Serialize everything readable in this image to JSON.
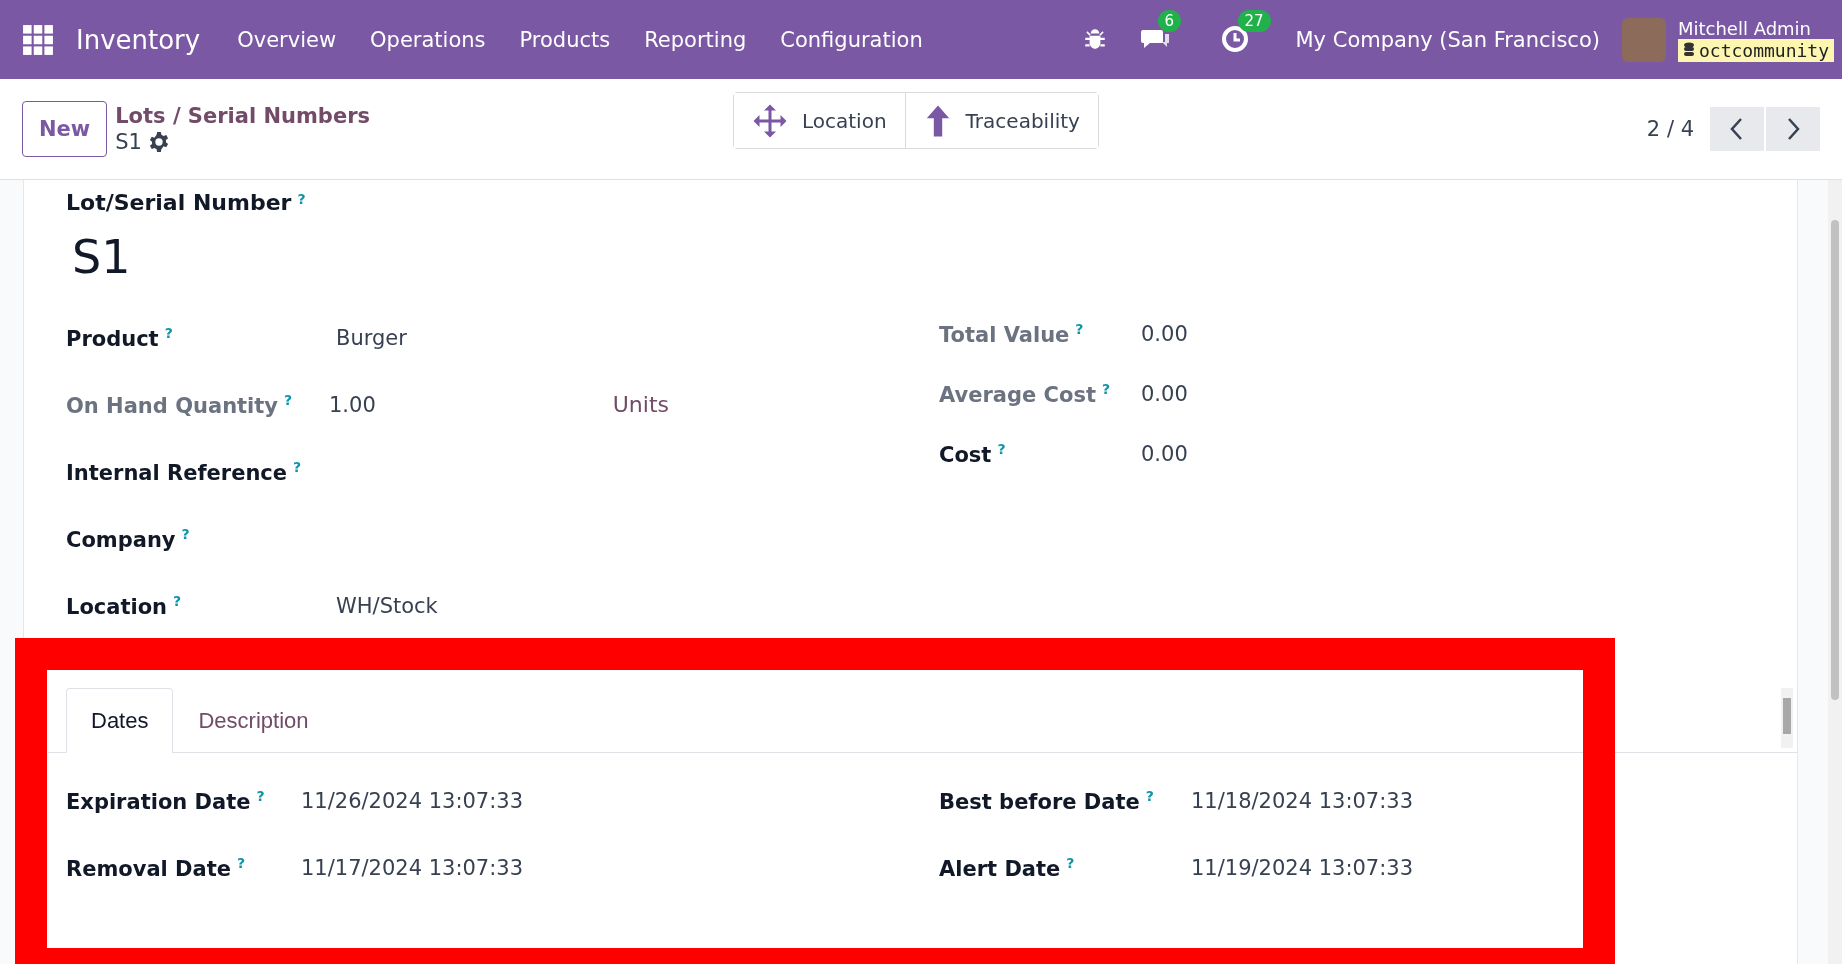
{
  "navbar": {
    "brand": "Inventory",
    "menu": [
      "Overview",
      "Operations",
      "Products",
      "Reporting",
      "Configuration"
    ],
    "messages_badge": "6",
    "activities_badge": "27",
    "company": "My Company (San Francisco)",
    "user": "Mitchell Admin",
    "database": "octcommunity"
  },
  "control_panel": {
    "new_button": "New",
    "breadcrumb": "Lots / Serial Numbers",
    "record": "S1",
    "smart_buttons": [
      {
        "kind": "location",
        "label": "Location"
      },
      {
        "kind": "traceability",
        "label": "Traceability"
      }
    ],
    "pager": "2 / 4"
  },
  "form": {
    "title_label": "Lot/Serial Number",
    "title_help": "?",
    "title": "S1",
    "left_fields": [
      {
        "label": "Product",
        "help": "?",
        "muted": false,
        "value": "Burger"
      },
      {
        "label": "On Hand Quantity",
        "help": "?",
        "muted": true,
        "value": "1.00",
        "unit": "Units"
      },
      {
        "label": "Internal Reference",
        "help": "?",
        "muted": false
      },
      {
        "label": "Company",
        "help": "?",
        "muted": false
      },
      {
        "label": "Location",
        "help": "?",
        "muted": false,
        "value": "WH/Stock"
      }
    ],
    "right_fields": [
      {
        "label": "Total Value",
        "help": "?",
        "muted": true,
        "value": "0.00"
      },
      {
        "label": "Average Cost",
        "help": "?",
        "muted": true,
        "value": "0.00"
      },
      {
        "label": "Cost",
        "help": "?",
        "muted": false,
        "value": "0.00"
      }
    ],
    "tabs": [
      {
        "label": "Dates",
        "selected": true
      },
      {
        "label": "Description",
        "selected": false
      }
    ],
    "date_fields_left": [
      {
        "label": "Expiration Date",
        "help": "?",
        "value": "11/26/2024 13:07:33"
      },
      {
        "label": "Removal Date",
        "help": "?",
        "value": "11/17/2024 13:07:33"
      }
    ],
    "date_fields_right": [
      {
        "label": "Best before Date",
        "help": "?",
        "value": "11/18/2024 13:07:33"
      },
      {
        "label": "Alert Date",
        "help": "?",
        "value": "11/19/2024 13:07:33"
      }
    ]
  }
}
